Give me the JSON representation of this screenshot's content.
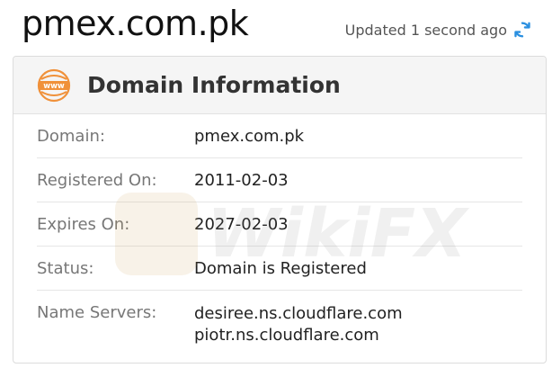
{
  "header": {
    "site_title": "pmex.com.pk",
    "updated_text": "Updated 1 second ago"
  },
  "card": {
    "title": "Domain Information",
    "icon_text": "www",
    "rows": [
      {
        "label": "Domain:",
        "value": "pmex.com.pk"
      },
      {
        "label": "Registered On:",
        "value": "2011-02-03"
      },
      {
        "label": "Expires On:",
        "value": "2027-02-03"
      },
      {
        "label": "Status:",
        "value": "Domain is Registered"
      },
      {
        "label": "Name Servers:",
        "values": [
          "desiree.ns.cloudflare.com",
          "piotr.ns.cloudflare.com"
        ]
      }
    ]
  },
  "watermark": {
    "text": "WikiFX"
  },
  "colors": {
    "accent_orange": "#f0913a",
    "refresh_blue": "#2a8fe0"
  }
}
